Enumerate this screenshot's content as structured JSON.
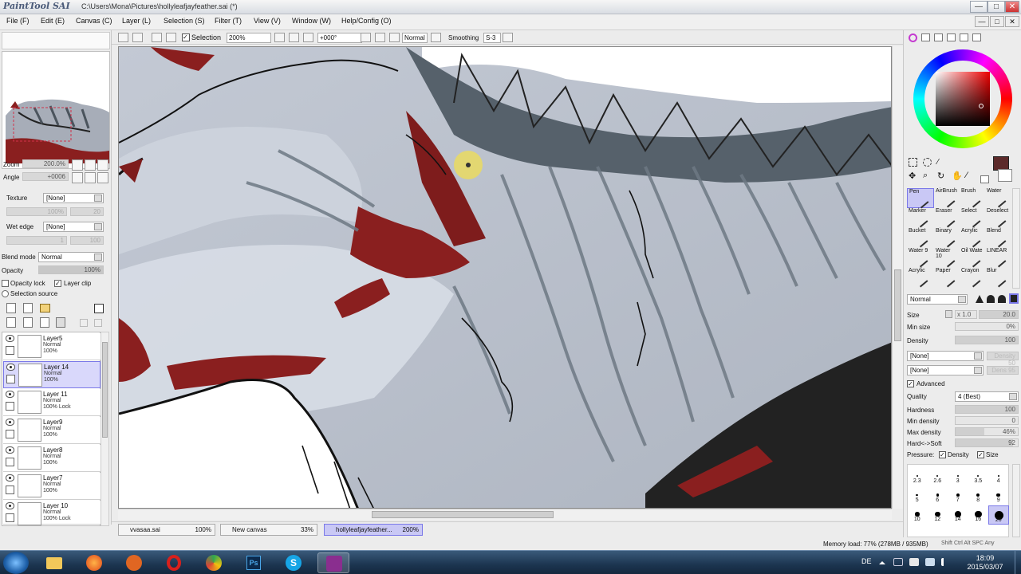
{
  "titlebar": {
    "app_logo": "PaintTool SAI",
    "file_path": "C:\\Users\\Mona\\Pictures\\hollyleafjayfeather.sai (*)",
    "minimize": "—",
    "maximize": "□",
    "close": "✕"
  },
  "menu": [
    "File (F)",
    "Edit (E)",
    "Canvas (C)",
    "Layer (L)",
    "Selection (S)",
    "Filter (T)",
    "View (V)",
    "Window (W)",
    "Help/Config (O)"
  ],
  "navigator": {
    "zoom_label": "Zoom",
    "zoom_value": "200.0%",
    "angle_label": "Angle",
    "angle_value": "+0006"
  },
  "layer_props": {
    "texture_label": "Texture",
    "texture_value": "[None]",
    "texture_scale": "100%",
    "texture_density": "20",
    "wet_edge_label": "Wet edge",
    "wet_edge_value": "[None]",
    "wet_edge_size": "1",
    "wet_edge_strength": "100",
    "blend_label": "Blend mode",
    "blend_value": "Normal",
    "opacity_label": "Opacity",
    "opacity_value": "100%",
    "opacity_lock": "Opacity lock",
    "layer_clip": "Layer clip",
    "selection_source": "Selection source"
  },
  "layers": [
    {
      "name": "Layer5",
      "mode": "Normal",
      "opacity": "100%"
    },
    {
      "name": "Layer 14",
      "mode": "Normal",
      "opacity": "100%"
    },
    {
      "name": "Layer 11",
      "mode": "Normal",
      "opacity": "100% Lock"
    },
    {
      "name": "Layer9",
      "mode": "Normal",
      "opacity": "100%"
    },
    {
      "name": "Layer8",
      "mode": "Normal",
      "opacity": "100%"
    },
    {
      "name": "Layer7",
      "mode": "Normal",
      "opacity": "100%"
    },
    {
      "name": "Layer 10",
      "mode": "Normal",
      "opacity": "100% Lock"
    }
  ],
  "canvas_toolbar": {
    "selection_label": "Selection",
    "zoom": "200%",
    "angle": "+000°",
    "mode": "Normal",
    "smoothing_label": "Smoothing",
    "smoothing_value": "S-3"
  },
  "tabs": [
    {
      "name": "vvasaa.sai",
      "zoom": "100%"
    },
    {
      "name": "New canvas",
      "zoom": "33%"
    },
    {
      "name": "hollyleafjayfeather...",
      "zoom": "200%"
    }
  ],
  "tools": [
    [
      "Pen",
      "AirBrush",
      "Brush",
      "Water"
    ],
    [
      "Marker",
      "Eraser",
      "Select",
      "Deselect"
    ],
    [
      "Bucket",
      "Binary",
      "Acrylic",
      "Blend"
    ],
    [
      "Water 9",
      "Water 10",
      "Oil Wate",
      "LINEAR"
    ],
    [
      "Acrylic",
      "Paper",
      "Crayon",
      "Blur"
    ]
  ],
  "brush": {
    "mode": "Normal",
    "size_label": "Size",
    "size_mult": "x 1.0",
    "size_value": "20.0",
    "min_size_label": "Min size",
    "min_size_value": "0%",
    "density_label": "Density",
    "density_value": "100",
    "shape1": "[None]",
    "shape1_val": "Density 50",
    "shape2": "[None]",
    "shape2_val": "Dens 95",
    "advanced_label": "Advanced",
    "quality_label": "Quality",
    "quality_value": "4 (Best)",
    "hardness_label": "Hardness",
    "hardness_value": "100",
    "min_density_label": "Min density",
    "min_density_value": "0",
    "max_density_label": "Max density",
    "max_density_value": "46%",
    "hard_soft_label": "Hard<->Soft",
    "hard_soft_value": "92",
    "pressure_label": "Pressure:",
    "pressure_density": "Density",
    "pressure_size": "Size"
  },
  "brush_sizes": [
    "2.3",
    "2.6",
    "3",
    "3.5",
    "4",
    "5",
    "6",
    "7",
    "8",
    "9",
    "10",
    "12",
    "14",
    "16",
    "20"
  ],
  "status": {
    "memory": "Memory load: 77% (278MB / 935MB)",
    "keys": "Shift Ctrl Alt SPC Any"
  },
  "taskbar": {
    "lang": "DE",
    "time": "18:09",
    "date": "2015/03/07"
  },
  "colors": {
    "current_color": "#5c2a2a",
    "canvas_bg": "#b9c0cc",
    "fur_dark": "#5a6670",
    "fur_red": "#8a1f1f",
    "selection_purple": "#7a78e8"
  }
}
